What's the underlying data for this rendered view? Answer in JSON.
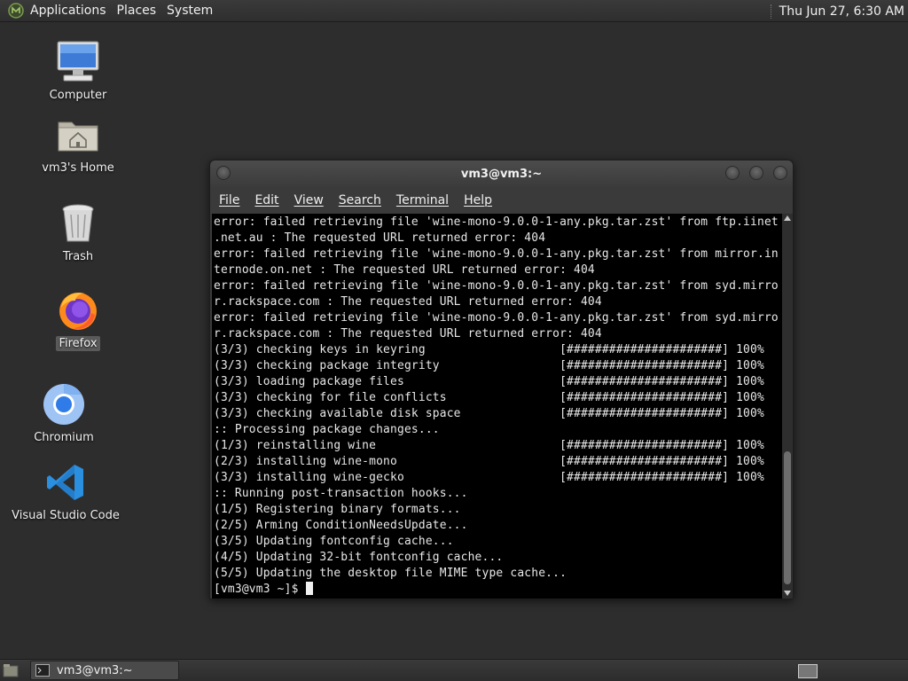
{
  "top_panel": {
    "menus": [
      "Applications",
      "Places",
      "System"
    ],
    "clock": "Thu Jun 27,  6:30 AM"
  },
  "desktop": {
    "icons": [
      {
        "label": "Computer",
        "icon": "computer-icon"
      },
      {
        "label": "vm3's Home",
        "icon": "home-folder-icon"
      },
      {
        "label": "Trash",
        "icon": "trash-icon"
      },
      {
        "label": "Firefox",
        "icon": "firefox-icon",
        "selected": true
      },
      {
        "label": "Chromium",
        "icon": "chromium-icon"
      },
      {
        "label": "Visual Studio Code",
        "icon": "vscode-icon"
      }
    ]
  },
  "terminal": {
    "title": "vm3@vm3:~",
    "menu": [
      "File",
      "Edit",
      "View",
      "Search",
      "Terminal",
      "Help"
    ],
    "lines": [
      "error: failed retrieving file 'wine-mono-9.0.0-1-any.pkg.tar.zst' from ftp.iinet",
      ".net.au : The requested URL returned error: 404",
      "error: failed retrieving file 'wine-mono-9.0.0-1-any.pkg.tar.zst' from mirror.in",
      "ternode.on.net : The requested URL returned error: 404",
      "error: failed retrieving file 'wine-mono-9.0.0-1-any.pkg.tar.zst' from syd.mirro",
      "r.rackspace.com : The requested URL returned error: 404",
      "error: failed retrieving file 'wine-mono-9.0.0-1-any.pkg.tar.zst' from syd.mirro",
      "r.rackspace.com : The requested URL returned error: 404",
      "(3/3) checking keys in keyring                   [######################] 100%",
      "(3/3) checking package integrity                 [######################] 100%",
      "(3/3) loading package files                      [######################] 100%",
      "(3/3) checking for file conflicts                [######################] 100%",
      "(3/3) checking available disk space              [######################] 100%",
      ":: Processing package changes...",
      "(1/3) reinstalling wine                          [######################] 100%",
      "(2/3) installing wine-mono                       [######################] 100%",
      "(3/3) installing wine-gecko                      [######################] 100%",
      ":: Running post-transaction hooks...",
      "(1/5) Registering binary formats...",
      "(2/5) Arming ConditionNeedsUpdate...",
      "(3/5) Updating fontconfig cache...",
      "(4/5) Updating 32-bit fontconfig cache...",
      "(5/5) Updating the desktop file MIME type cache..."
    ],
    "prompt": "[vm3@vm3 ~]$ "
  },
  "bottom_panel": {
    "task_label": "vm3@vm3:~"
  },
  "colors": {
    "desktop_bg": "#2d2d2d",
    "terminal_bg": "#000000",
    "terminal_fg": "#e8e8e8"
  }
}
